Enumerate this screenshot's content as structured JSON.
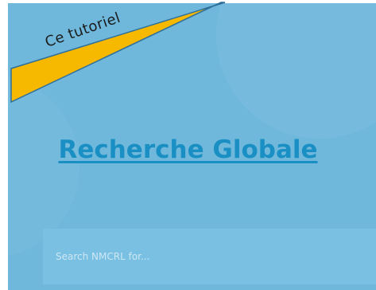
{
  "banner": {
    "label": "Ce tutoriel"
  },
  "heading": {
    "title": "Recherche Globale"
  },
  "search": {
    "placeholder": "Search NMCRL for..."
  },
  "colors": {
    "panel_background": "#6fb8dc",
    "banner_fill": "#f7b800",
    "banner_border": "#2e6f9a",
    "title_link": "#1a8fc4",
    "search_field": "#7ac0e2"
  }
}
